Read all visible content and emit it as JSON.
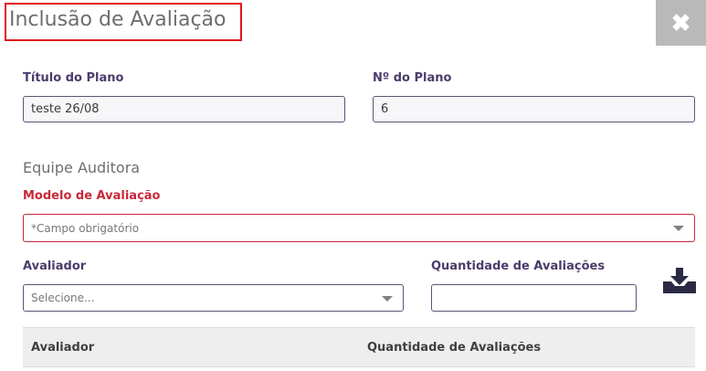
{
  "dialog": {
    "title": "Inclusão de Avaliação",
    "close_icon": "close-x-icon"
  },
  "fields": {
    "plan_title": {
      "label": "Título do Plano",
      "value": "teste 26/08"
    },
    "plan_number": {
      "label": "Nº do Plano",
      "value": "6"
    }
  },
  "section": {
    "title": "Equipe Auditora"
  },
  "model": {
    "label": "Modelo de Avaliação",
    "placeholder": "*Campo obrigatório"
  },
  "evaluator": {
    "label": "Avaliador",
    "placeholder": "Selecione..."
  },
  "quantity": {
    "label": "Quantidade de Avaliações",
    "value": ""
  },
  "add_icon": "download-tray-icon",
  "table": {
    "columns": [
      "Avaliador",
      "Quantidade de Avaliações"
    ]
  },
  "colors": {
    "label": "#4a3c6b",
    "required": "#c8283a",
    "highlight_border": "#e0141e",
    "close_bg": "#b9b9b9",
    "icon": "#2a2a45"
  }
}
